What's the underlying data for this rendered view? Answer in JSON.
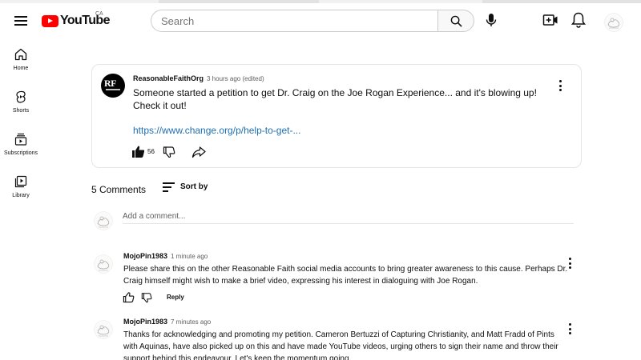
{
  "header": {
    "logo_text": "YouTube",
    "country_code": "CA",
    "search_placeholder": "Search",
    "icons": [
      "menu-icon",
      "search-icon",
      "mic-icon",
      "create-icon",
      "bell-icon"
    ]
  },
  "sidebar": {
    "items": [
      {
        "label": "Home",
        "icon": "home-icon"
      },
      {
        "label": "Shorts",
        "icon": "shorts-icon"
      },
      {
        "label": "Subscriptions",
        "icon": "subscriptions-icon"
      },
      {
        "label": "Library",
        "icon": "library-icon"
      }
    ]
  },
  "post": {
    "avatar_text": "RF",
    "author": "ReasonableFaithOrg",
    "time": "3 hours ago (edited)",
    "text": "Someone started a petition to get Dr. Craig on the Joe Rogan Experience... and it's blowing up! Check it out!",
    "link": "https://www.change.org/p/help-to-get-...",
    "likes": "56"
  },
  "comments_section": {
    "count_label": "5 Comments",
    "sort_label": "Sort by",
    "add_placeholder": "Add a comment...",
    "reply_label": "Reply",
    "comments": [
      {
        "author": "MojoPin1983",
        "time": "1 minute ago",
        "text": "Please share this on the other Reasonable Faith social media accounts to bring greater awareness to this cause.  Perhaps Dr. Craig himself might wish to make a brief video, expressing his interest in dialoguing with Joe Rogan."
      },
      {
        "author": "MojoPin1983",
        "time": "7 minutes ago",
        "text": "Thanks for acknowledging and promoting my petition.  Cameron Bertuzzi of Capturing Christianity, and Matt Fradd of Pints with Aquinas, have also picked up on this and have made YouTube videos, urging others to sign their name and throw their support behind this endeavour.  Let's keep the momentum going."
      }
    ]
  },
  "colors": {
    "brand_red": "#ff0000",
    "link_blue": "#1f6fb2",
    "text_primary": "#0f0f0f",
    "text_secondary": "#606060",
    "border": "#e5e5e5"
  }
}
